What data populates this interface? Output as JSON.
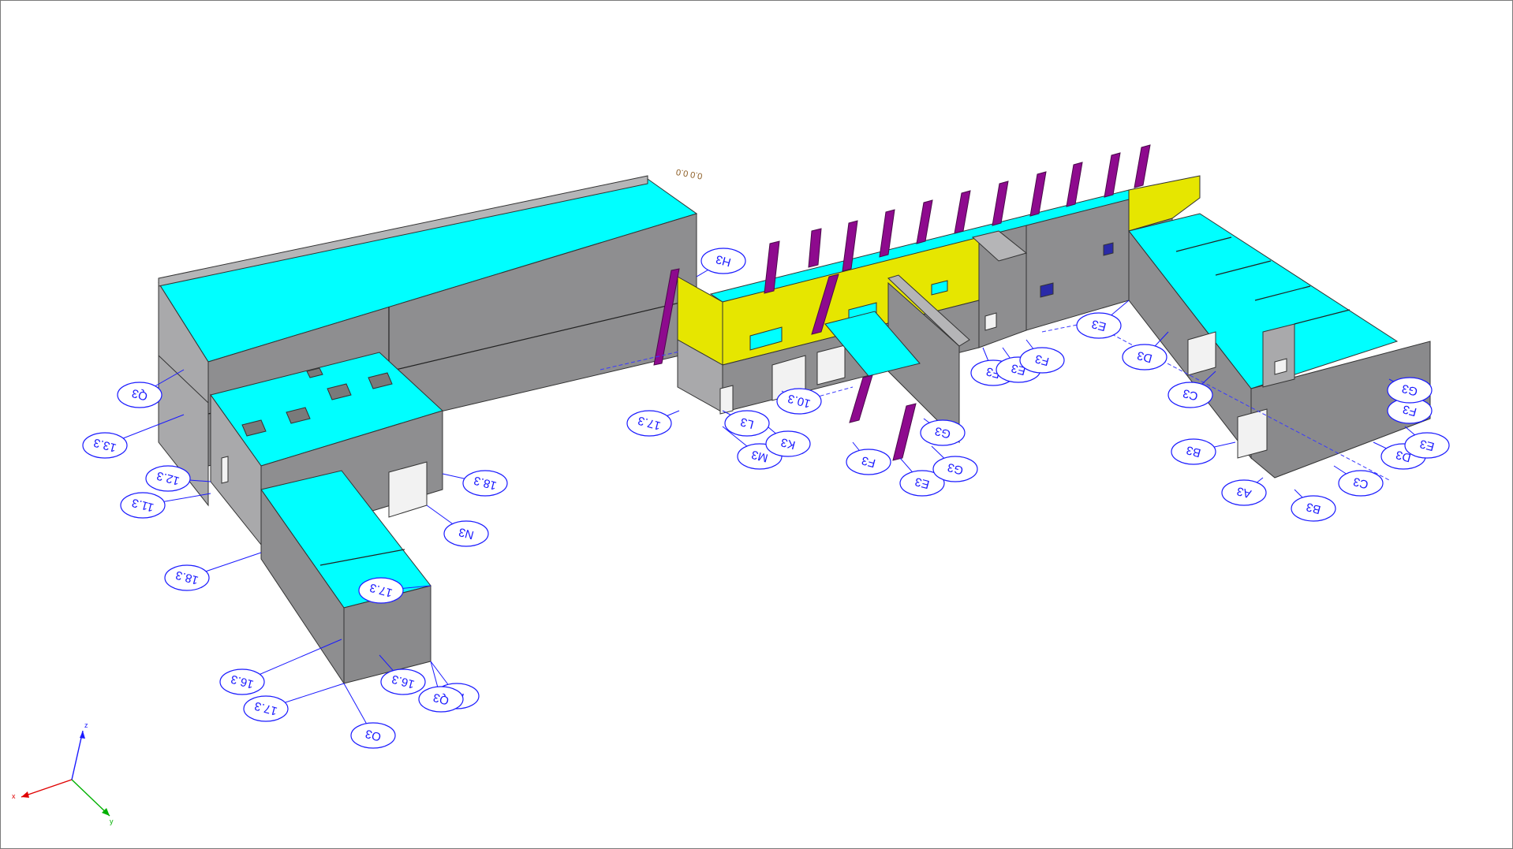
{
  "colors": {
    "wall_front": "#8e8e90",
    "wall_side": "#a9a9ab",
    "wall_dark": "#6f6f72",
    "roof": "#00ffff",
    "accent_wall": "#e6e600",
    "column": "#8e0a8e",
    "grid_line": "#1a1aff",
    "axis_x": "#e00000",
    "axis_y": "#00b000",
    "axis_z": "#1a1aff"
  },
  "grid_labels": [
    "Q3",
    "13.3",
    "12.3",
    "11.3",
    "18.3",
    "17.3",
    "16.3",
    "17.3",
    "16.3",
    "P3",
    "O3",
    "Q3",
    "18.3",
    "N3",
    "H3",
    "17.3",
    "M3",
    "K3",
    "L3",
    "10.3",
    "F3",
    "E3",
    "G3",
    "G3",
    "F3",
    "E3",
    "F3",
    "E3",
    "D3",
    "C3",
    "B3",
    "A3",
    "B3",
    "C3",
    "D3",
    "E3",
    "F3",
    "G3"
  ],
  "annotation_text": "0.0 0.0",
  "axes": {
    "x": "x",
    "y": "y",
    "z": "z"
  }
}
